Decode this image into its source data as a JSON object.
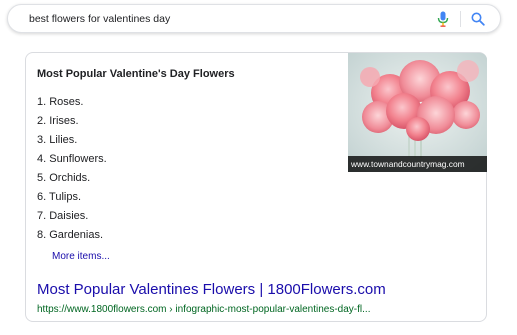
{
  "search": {
    "query": "best flowers for valentines day",
    "mic_icon": "microphone-icon",
    "search_icon": "magnifier-icon"
  },
  "snippet": {
    "title": "Most Popular Valentine's Day Flowers",
    "items": [
      "1. Roses.",
      "2. Irises.",
      "3. Lilies.",
      "4. Sunflowers.",
      "5. Orchids.",
      "6. Tulips.",
      "7. Daisies.",
      "8. Gardenias."
    ],
    "more_label": "More items...",
    "image_caption": "www.townandcountrymag.com"
  },
  "result": {
    "title": "Most Popular Valentines Flowers | 1800Flowers.com",
    "url": "https://www.1800flowers.com › infographic-most-popular-valentines-day-fl..."
  },
  "colors": {
    "link": "#1a0dab",
    "url_green": "#006621",
    "text": "#202124",
    "border": "#dadce0"
  }
}
